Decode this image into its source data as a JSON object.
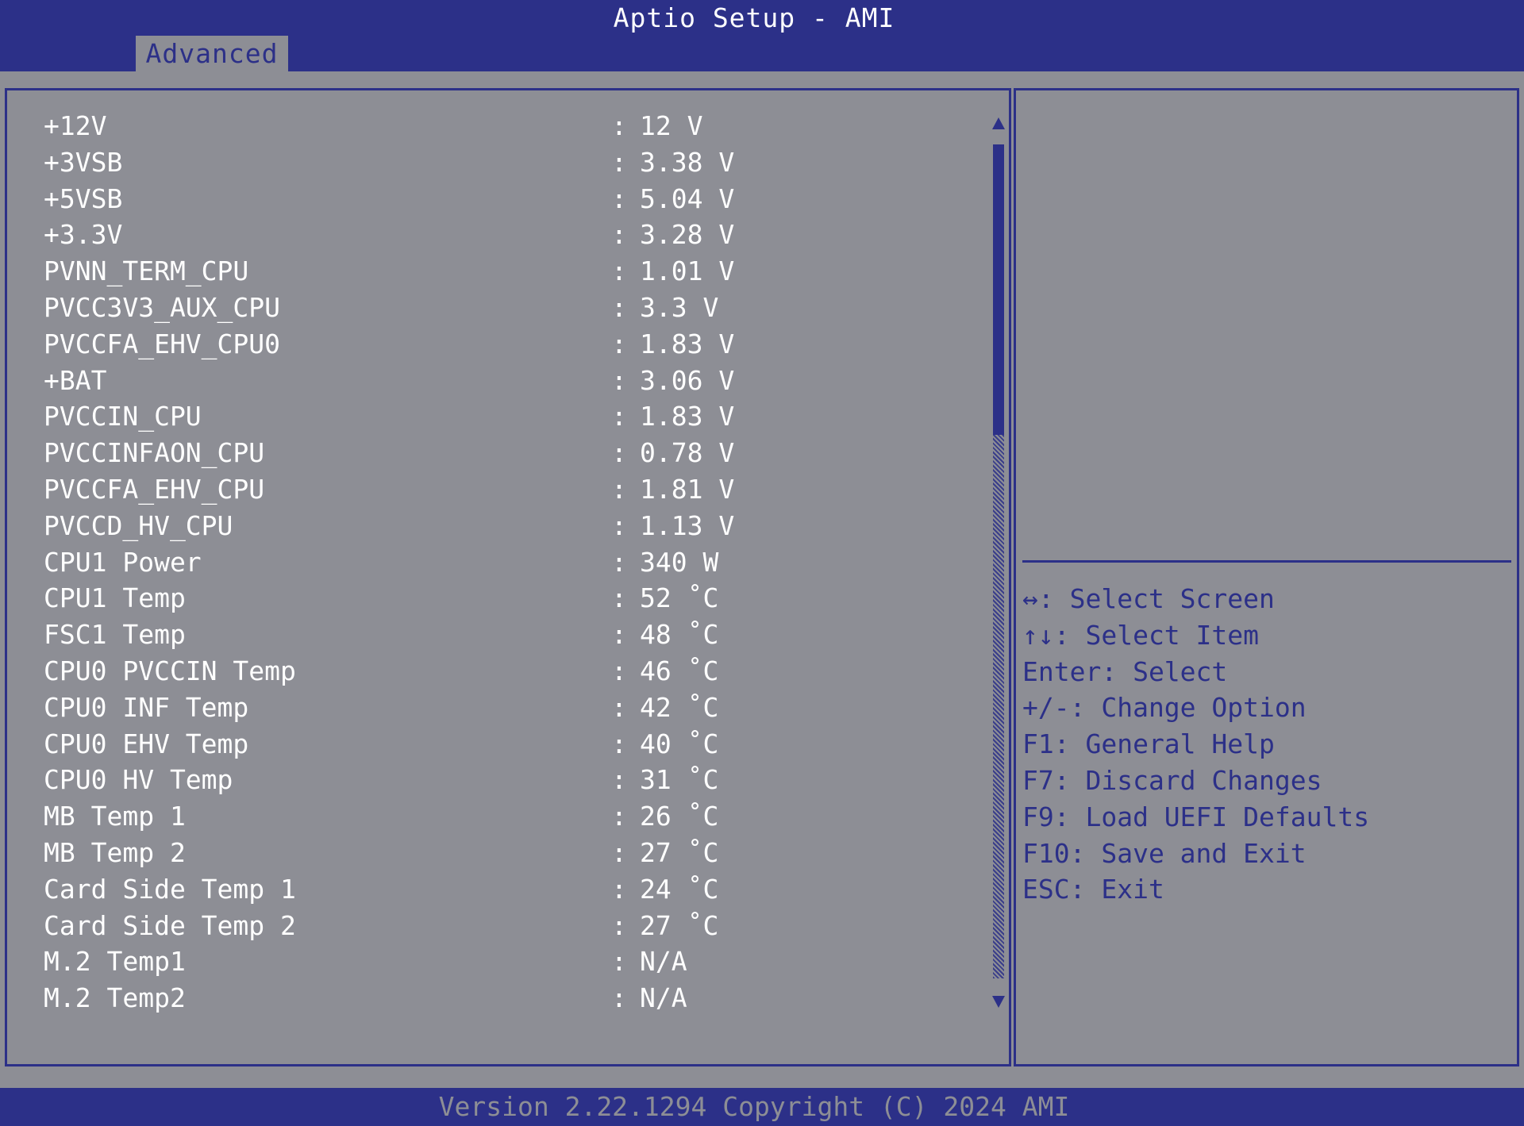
{
  "window": {
    "title": "Aptio Setup - AMI"
  },
  "tabs": [
    {
      "label": "Advanced",
      "active": true
    }
  ],
  "sensors": [
    {
      "label": "+12V",
      "value": "12 V"
    },
    {
      "label": "+3VSB",
      "value": "3.38 V"
    },
    {
      "label": "+5VSB",
      "value": "5.04 V"
    },
    {
      "label": "+3.3V",
      "value": "3.28 V"
    },
    {
      "label": "PVNN_TERM_CPU",
      "value": "1.01 V"
    },
    {
      "label": "PVCC3V3_AUX_CPU",
      "value": "3.3 V"
    },
    {
      "label": "PVCCFA_EHV_CPU0",
      "value": "1.83 V"
    },
    {
      "label": "+BAT",
      "value": "3.06 V"
    },
    {
      "label": "PVCCIN_CPU",
      "value": "1.83 V"
    },
    {
      "label": "PVCCINFAON_CPU",
      "value": "0.78 V"
    },
    {
      "label": "PVCCFA_EHV_CPU",
      "value": "1.81 V"
    },
    {
      "label": "PVCCD_HV_CPU",
      "value": "1.13 V"
    },
    {
      "label": "CPU1 Power",
      "value": "340 W"
    },
    {
      "label": "CPU1 Temp",
      "value": "52 ˚C"
    },
    {
      "label": "FSC1 Temp",
      "value": "48 ˚C"
    },
    {
      "label": "CPU0 PVCCIN Temp",
      "value": "46 ˚C"
    },
    {
      "label": "CPU0 INF Temp",
      "value": "42 ˚C"
    },
    {
      "label": "CPU0 EHV Temp",
      "value": "40 ˚C"
    },
    {
      "label": "CPU0 HV Temp",
      "value": "31 ˚C"
    },
    {
      "label": "MB Temp 1",
      "value": "26 ˚C"
    },
    {
      "label": "MB Temp 2",
      "value": "27 ˚C"
    },
    {
      "label": "Card Side Temp 1",
      "value": "24 ˚C"
    },
    {
      "label": "Card Side Temp 2",
      "value": "27 ˚C"
    },
    {
      "label": "M.2 Temp1",
      "value": "N/A"
    },
    {
      "label": "M.2 Temp2",
      "value": "N/A"
    }
  ],
  "separator": ":",
  "help": [
    "↔: Select Screen",
    "↑↓: Select Item",
    "Enter: Select",
    "+/-: Change Option",
    "F1: General Help",
    "F7: Discard Changes",
    "F9: Load UEFI Defaults",
    "F10: Save and Exit",
    "ESC: Exit"
  ],
  "footer": {
    "text": "Version 2.22.1294 Copyright (C) 2024 AMI"
  },
  "colors": {
    "header_bg": "#2c3088",
    "panel_bg": "#8d8e95",
    "item_text": "#ffffff",
    "help_text": "#2c3088"
  }
}
